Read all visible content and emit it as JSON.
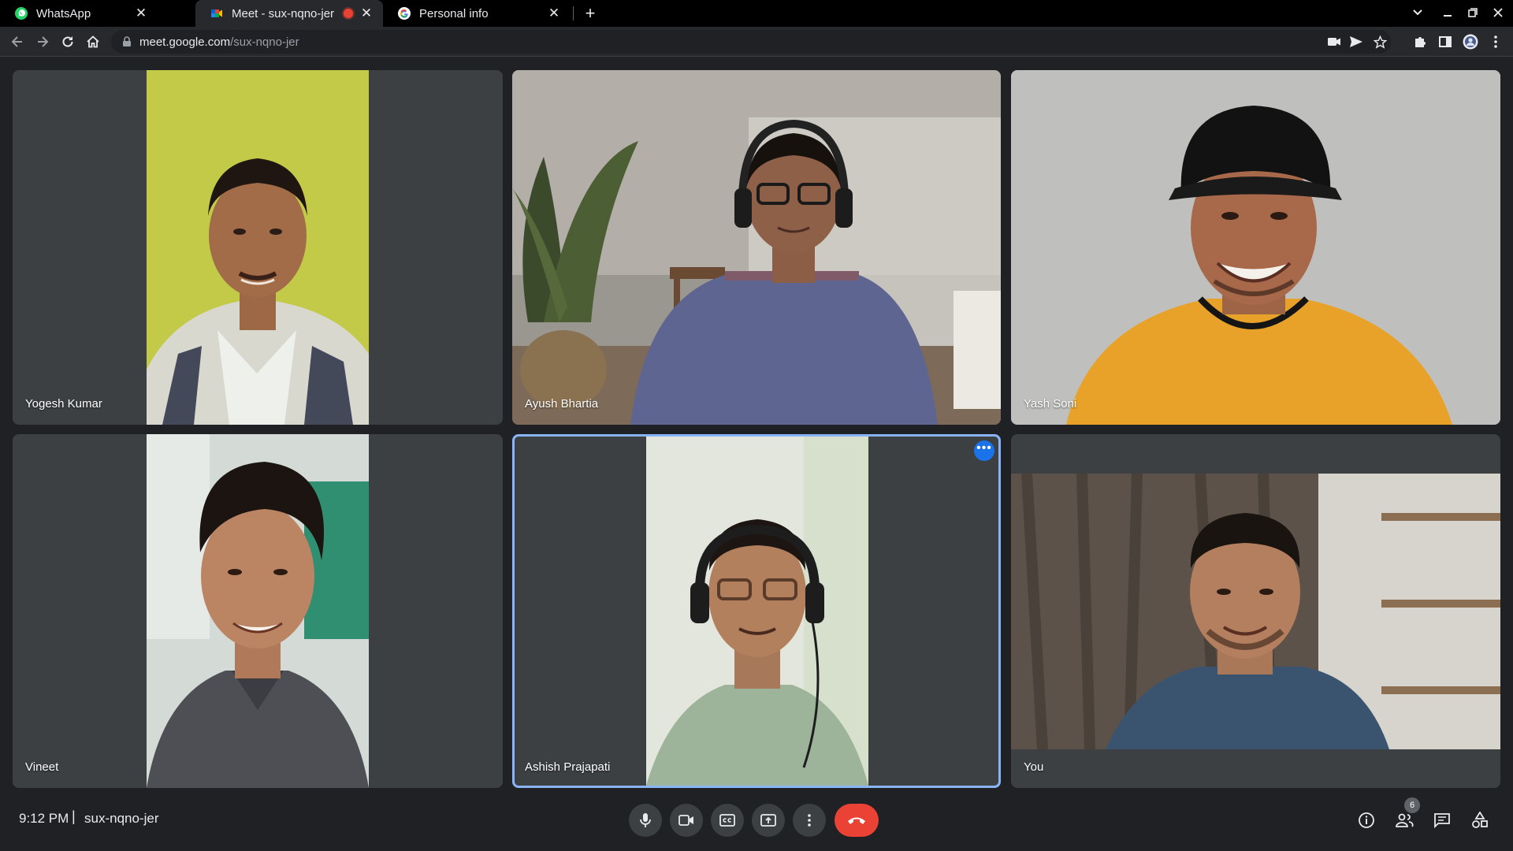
{
  "tabs": [
    {
      "title": "WhatsApp",
      "icon": "whatsapp-icon"
    },
    {
      "title": "Meet - sux-nqno-jer",
      "icon": "google-meet-icon",
      "recording": true
    },
    {
      "title": "Personal info",
      "icon": "google-icon"
    }
  ],
  "address": {
    "host": "meet.google.com",
    "path": "/sux-nqno-jer"
  },
  "participants": [
    {
      "name": "Yogesh Kumar"
    },
    {
      "name": "Ayush Bhartia"
    },
    {
      "name": "Yash Soni"
    },
    {
      "name": "Vineet"
    },
    {
      "name": "Ashish Prajapati"
    },
    {
      "name": "You"
    }
  ],
  "meeting": {
    "time": "9:12 PM",
    "separator": "|",
    "code": "sux-nqno-jer",
    "participant_count": "6"
  },
  "colors": {
    "accent": "#8ab4f8",
    "end_call": "#ea4335",
    "tile_bg": "#3c4043",
    "page_bg": "#202124"
  }
}
